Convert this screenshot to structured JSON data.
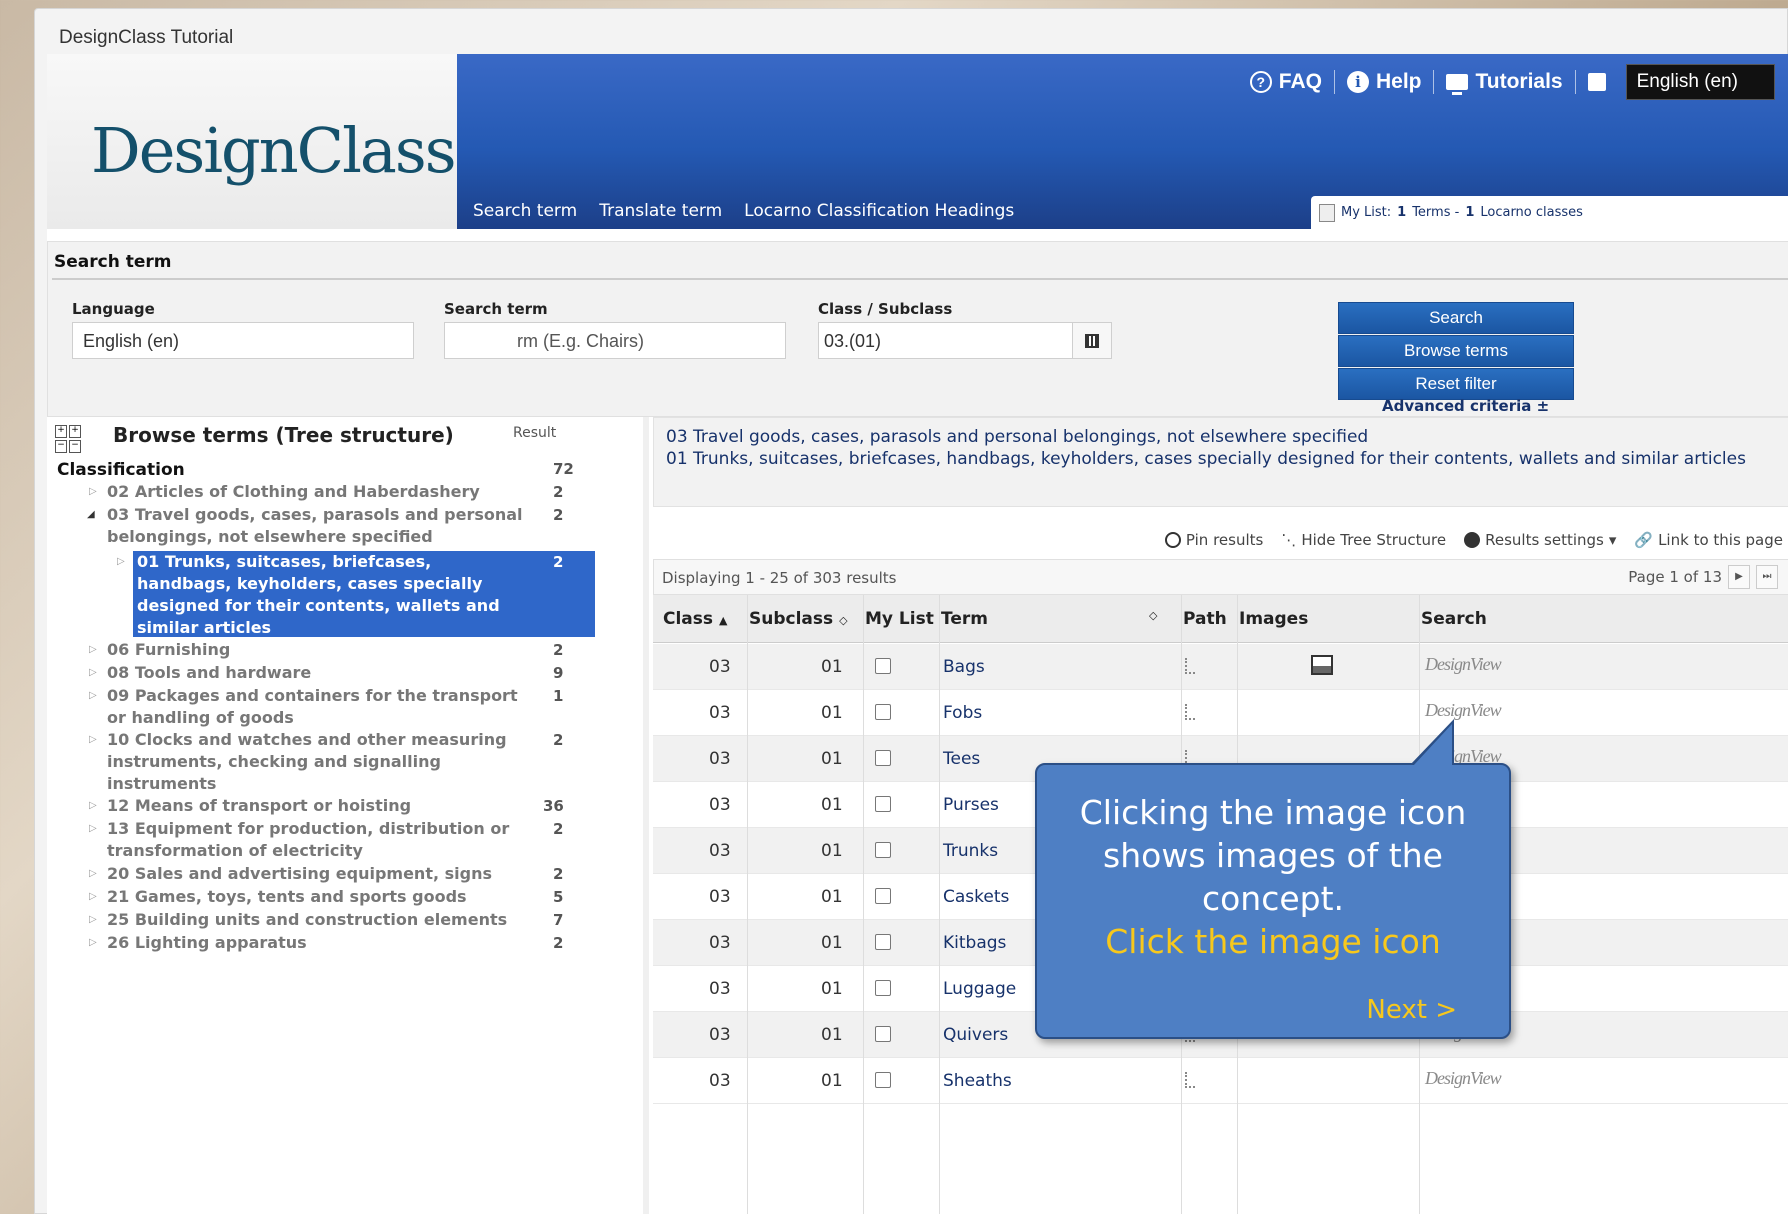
{
  "window": {
    "title": "DesignClass Tutorial"
  },
  "header": {
    "logo": "DesignClass",
    "top_links": [
      "FAQ",
      "Help",
      "Tutorials"
    ],
    "language": "English (en)",
    "nav": [
      "Search term",
      "Translate term",
      "Locarno Classification Headings"
    ],
    "mylist": {
      "label": "My List:",
      "terms_count": "1",
      "terms_label": "Terms -",
      "classes_count": "1",
      "classes_label": "Locarno classes"
    }
  },
  "search": {
    "title": "Search term",
    "language_label": "Language",
    "language_value": "English (en)",
    "term_label": "Search term",
    "term_placeholder": "rm (E.g. Chairs)",
    "class_label": "Class / Subclass",
    "class_value": "03.(01)",
    "buttons": [
      "Search",
      "Browse terms",
      "Reset filter"
    ],
    "advanced": "Advanced criteria ±"
  },
  "tree": {
    "title": "Browse terms (Tree structure)",
    "result_label": "Result",
    "root": {
      "label": "Classification",
      "count": "72"
    },
    "items": [
      {
        "label": "02 Articles of Clothing and Haberdashery",
        "count": "2"
      },
      {
        "label": "03 Travel goods, cases, parasols and personal belongings, not elsewhere specified",
        "count": "2"
      },
      {
        "label": "01 Trunks, suitcases, briefcases, handbags, keyholders, cases specially designed for their contents, wallets and similar articles",
        "count": "2"
      },
      {
        "label": "06 Furnishing",
        "count": "2"
      },
      {
        "label": "08 Tools and hardware",
        "count": "9"
      },
      {
        "label": "09 Packages and containers for the transport or handling of goods",
        "count": "1"
      },
      {
        "label": "10 Clocks and watches and other measuring instruments, checking and signalling instruments",
        "count": "2"
      },
      {
        "label": "12 Means of transport or hoisting",
        "count": "36"
      },
      {
        "label": "13 Equipment for production, distribution or transformation of electricity",
        "count": "2"
      },
      {
        "label": "20 Sales and advertising equipment, signs",
        "count": "2"
      },
      {
        "label": "21 Games, toys, tents and sports goods",
        "count": "5"
      },
      {
        "label": "25 Building units and construction elements",
        "count": "7"
      },
      {
        "label": "26 Lighting apparatus",
        "count": "2"
      }
    ]
  },
  "results": {
    "crumb_line1": "03 Travel goods, cases, parasols and personal belongings, not elsewhere specified",
    "crumb_line2": "01 Trunks, suitcases, briefcases, handbags, keyholders, cases specially designed for their contents, wallets and similar articles",
    "toolbar": [
      "Pin results",
      "Hide Tree Structure",
      "Results settings",
      "Link to this page"
    ],
    "displaying": "Displaying 1 - 25 of 303 results",
    "page": "Page 1 of 13",
    "columns": [
      "Class",
      "Subclass",
      "My List",
      "Term",
      "Path",
      "Images",
      "Search"
    ],
    "search_tool": "DesignView",
    "rows": [
      {
        "class": "03",
        "subclass": "01",
        "term": "Bags"
      },
      {
        "class": "03",
        "subclass": "01",
        "term": "Fobs"
      },
      {
        "class": "03",
        "subclass": "01",
        "term": "Tees"
      },
      {
        "class": "03",
        "subclass": "01",
        "term": "Purses"
      },
      {
        "class": "03",
        "subclass": "01",
        "term": "Trunks"
      },
      {
        "class": "03",
        "subclass": "01",
        "term": "Caskets"
      },
      {
        "class": "03",
        "subclass": "01",
        "term": "Kitbags"
      },
      {
        "class": "03",
        "subclass": "01",
        "term": "Luggage"
      },
      {
        "class": "03",
        "subclass": "01",
        "term": "Quivers"
      },
      {
        "class": "03",
        "subclass": "01",
        "term": "Sheaths"
      }
    ]
  },
  "tooltip": {
    "text": "Clicking the image icon shows images of the concept.",
    "action": "Click the image icon",
    "next": "Next >"
  }
}
